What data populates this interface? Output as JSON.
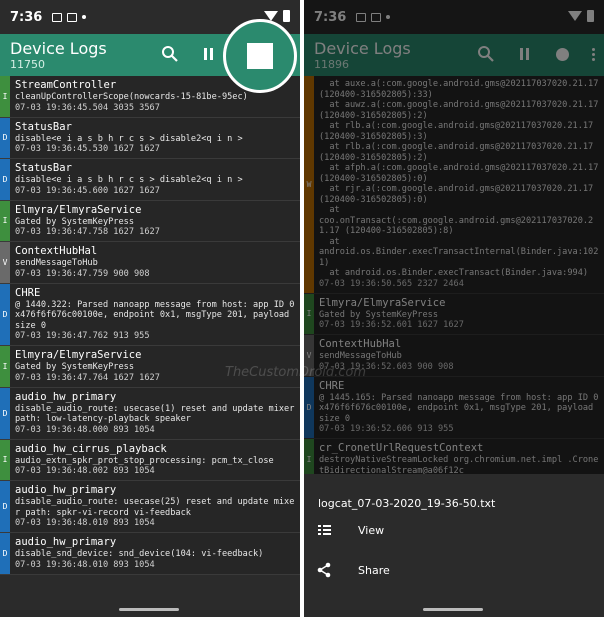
{
  "status": {
    "time": "7:36"
  },
  "app": {
    "title": "Device Logs"
  },
  "left": {
    "count": "11750",
    "entries": [
      {
        "level": "I",
        "tag": "StreamController",
        "message": "cleanUpControllerScope(nowcards-15-81be-95ec)",
        "meta": "07-03 19:36:45.504 3035 3567"
      },
      {
        "level": "D",
        "tag": "StatusBar",
        "message": "disable<e i a s b h r c s > disable2<q i n >",
        "meta": "07-03 19:36:45.530 1627 1627"
      },
      {
        "level": "D",
        "tag": "StatusBar",
        "message": "disable<e i a s b h r c s > disable2<q i n >",
        "meta": "07-03 19:36:45.600 1627 1627"
      },
      {
        "level": "I",
        "tag": "Elmyra/ElmyraService",
        "message": "Gated by SystemKeyPress",
        "meta": "07-03 19:36:47.758 1627 1627"
      },
      {
        "level": "V",
        "tag": "ContextHubHal",
        "message": "sendMessageToHub",
        "meta": "07-03 19:36:47.759 900 908"
      },
      {
        "level": "D",
        "tag": "CHRE",
        "message": "@ 1440.322: Parsed nanoapp message from host: app ID 0x476f6f676c00100e, endpoint 0x1, msgType 201, payload size 0",
        "meta": "07-03 19:36:47.762 913 955"
      },
      {
        "level": "I",
        "tag": "Elmyra/ElmyraService",
        "message": "Gated by SystemKeyPress",
        "meta": "07-03 19:36:47.764 1627 1627"
      },
      {
        "level": "D",
        "tag": "audio_hw_primary",
        "message": "disable_audio_route: usecase(1) reset and update mixer path: low-latency-playback speaker",
        "meta": "07-03 19:36:48.000 893 1054"
      },
      {
        "level": "I",
        "tag": "audio_hw_cirrus_playback",
        "message": "audio_extn_spkr_prot_stop_processing: pcm_tx_close",
        "meta": "07-03 19:36:48.002 893 1054"
      },
      {
        "level": "D",
        "tag": "audio_hw_primary",
        "message": "disable_audio_route: usecase(25) reset and update mixer path: spkr-vi-record vi-feedback",
        "meta": "07-03 19:36:48.010 893 1054"
      },
      {
        "level": "D",
        "tag": "audio_hw_primary",
        "message": "disable_snd_device: snd_device(104: vi-feedback)",
        "meta": "07-03 19:36:48.010 893 1054"
      }
    ]
  },
  "right": {
    "count": "11896",
    "entries": [
      {
        "level": "W",
        "tag": "",
        "message": "  at auxe.a(:com.google.android.gms@202117037020.21.17 (120400-316502805):33)\n  at auwz.a(:com.google.android.gms@202117037020.21.17 (120400-316502805):2)\n  at rlb.a(:com.google.android.gms@202117037020.21.17 (120400-316502805):3)\n  at rlb.a(:com.google.android.gms@202117037020.21.17 (120400-316502805):2)\n  at afph.a(:com.google.android.gms@202117037020.21.17 (120400-316502805):0)\n  at rjr.a(:com.google.android.gms@202117037020.21.17 (120400-316502805):0)\n  at\ncoo.onTransact(:com.google.android.gms@202117037020.21.17 (120400-316502805):8)\n  at\nandroid.os.Binder.execTransactInternal(Binder.java:1021)\n  at android.os.Binder.execTransact(Binder.java:994)",
        "meta": "07-03 19:36:50.565 2327 2464"
      },
      {
        "level": "I",
        "tag": "Elmyra/ElmyraService",
        "message": "Gated by SystemKeyPress",
        "meta": "07-03 19:36:52.601 1627 1627"
      },
      {
        "level": "V",
        "tag": "ContextHubHal",
        "message": "sendMessageToHub",
        "meta": "07-03 19:36:52.603 900 908"
      },
      {
        "level": "D",
        "tag": "CHRE",
        "message": "@ 1445.165: Parsed nanoapp message from host: app ID 0x476f6f676c00100e, endpoint 0x1, msgType 201, payload size 0",
        "meta": "07-03 19:36:52.606 913 955"
      },
      {
        "level": "I",
        "tag": "cr_CronetUrlRequestContext",
        "message": "destroyNativeStreamLocked org.chromium.net.impl .CronetBidirectionalStream@a06f12c",
        "meta": ""
      }
    ]
  },
  "sheet": {
    "filename": "logcat_07-03-2020_19-36-50.txt",
    "items": [
      {
        "label": "View",
        "icon": "list-icon"
      },
      {
        "label": "Share",
        "icon": "share-icon"
      }
    ]
  },
  "watermark": "TheCustomDroid.com"
}
